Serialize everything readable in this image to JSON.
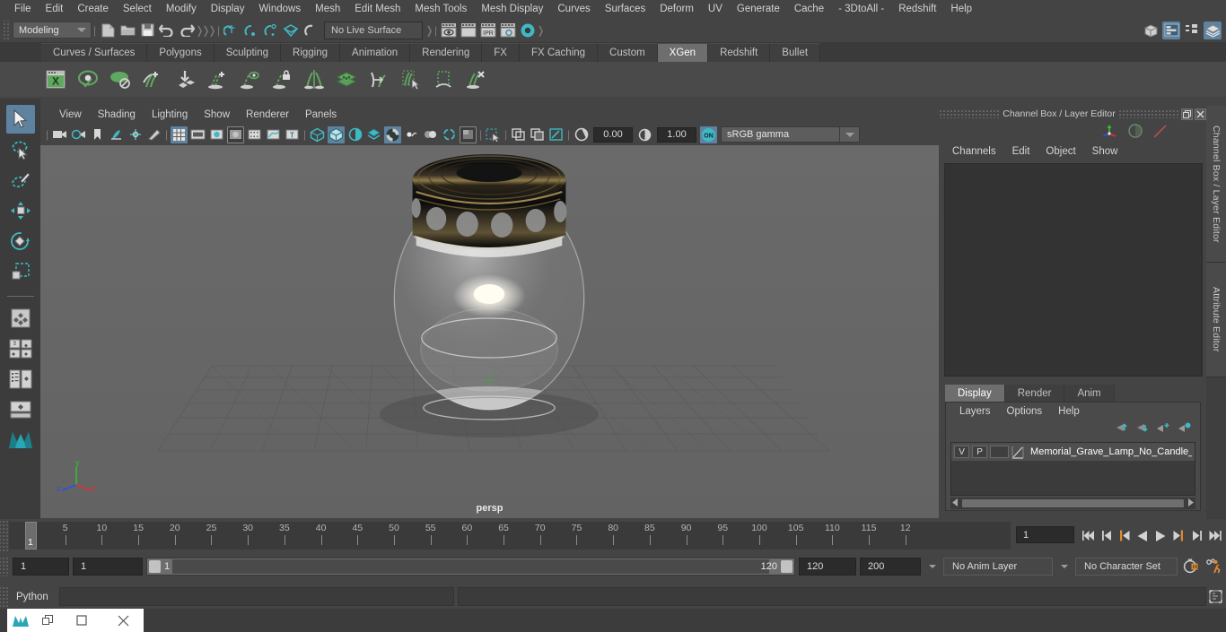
{
  "menubar": {
    "items": [
      "File",
      "Edit",
      "Create",
      "Select",
      "Modify",
      "Display",
      "Windows",
      "Mesh",
      "Edit Mesh",
      "Mesh Tools",
      "Mesh Display",
      "Curves",
      "Surfaces",
      "Deform",
      "UV",
      "Generate",
      "Cache",
      "- 3DtoAll -",
      "Redshift",
      "Help"
    ]
  },
  "statusbar": {
    "mode_menu": "Modeling",
    "live_surface": "No Live Surface",
    "icons": [
      "new-scene-icon",
      "open-scene-icon",
      "save-scene-icon",
      "undo-icon",
      "redo-icon",
      "select-by-hierarchy-icon",
      "select-by-object-icon",
      "select-by-component-icon",
      "snap-to-grid-icon",
      "snap-to-curve-icon",
      "snap-to-point-icon",
      "snap-to-projected-center-icon",
      "snap-to-view-plane-icon",
      "make-live-icon",
      "render-current-frame-icon",
      "render-sequence-icon",
      "ipr-render-icon",
      "render-settings-icon",
      "hypershade-icon"
    ],
    "right_icons": [
      "show-hide-modeling-toolkit-icon",
      "attribute-editor-icon",
      "tool-settings-icon",
      "channel-box-layer-editor-icon"
    ]
  },
  "shelf": {
    "tabs": [
      "Curves / Surfaces",
      "Polygons",
      "Sculpting",
      "Rigging",
      "Animation",
      "Rendering",
      "FX",
      "FX Caching",
      "Custom",
      "XGen",
      "Redshift",
      "Bullet"
    ],
    "active_tab": "XGen",
    "icons": [
      "xgen-editor-icon",
      "xgen-preview-icon",
      "xgen-disable-preview-icon",
      "xgen-add-groom-icon",
      "xgen-import-collection-icon",
      "xgen-create-description-icon",
      "xgen-preview-description-icon",
      "xgen-lock-description-icon",
      "xgen-mirror-description-icon",
      "xgen-guide-layers-icon",
      "xgen-convert-to-interactive-icon",
      "xgen-select-guides-icon",
      "xgen-region-tool-icon",
      "xgen-delete-guides-icon"
    ]
  },
  "toolbox": {
    "items": [
      {
        "name": "select-tool",
        "selected": true
      },
      {
        "name": "lasso-select-tool",
        "selected": false
      },
      {
        "name": "paint-select-tool",
        "selected": false
      },
      {
        "name": "move-tool",
        "selected": false
      },
      {
        "name": "rotate-tool",
        "selected": false
      },
      {
        "name": "scale-tool",
        "selected": false
      },
      {
        "name": "last-tool-used",
        "selected": false
      },
      {
        "name": "four-view-layout-icon",
        "selected": false
      },
      {
        "name": "persp-outliner-layout-icon",
        "selected": false
      },
      {
        "name": "persp-graph-layout-icon",
        "selected": false
      },
      {
        "name": "single-perspective-layout-icon",
        "selected": false
      },
      {
        "name": "maya-logo-icon",
        "selected": false
      }
    ]
  },
  "viewport": {
    "menu": [
      "View",
      "Shading",
      "Lighting",
      "Show",
      "Renderer",
      "Panels"
    ],
    "toolbar_values": {
      "exposure": "0.00",
      "gamma": "1.00",
      "color_space": "sRGB gamma",
      "view_transform_toggle": "ON"
    },
    "toolbar_icons": [
      "select-camera-icon",
      "camera-attributes-icon",
      "bookmark-icon",
      "image-plane-icon",
      "two-d-pan-zoom-icon",
      "grease-pencil-icon",
      "grid-icon",
      "film-gate-icon",
      "resolution-gate-icon",
      "gate-mask-icon",
      "film-origin-icon",
      "exposure-icon",
      "safe-title-icon",
      "wireframe-shading-icon",
      "smooth-shade-all-icon",
      "shaded-wireframe-icon",
      "use-all-lights-icon",
      "shadows-icon",
      "ambient-occlusion-icon",
      "motion-blur-icon",
      "anti-alias-icon",
      "multisample-icon",
      "depth-of-field-icon",
      "isolate-select-icon",
      "xray-icon",
      "xray-joints-icon",
      "xray-active-components-icon"
    ],
    "camera_label": "persp",
    "axis_labels": {
      "x": "x",
      "y": "y",
      "z": "z"
    },
    "scene_description": "transparent glass memorial grave lamp with black perforated metal lid on a ground grid"
  },
  "right_panel": {
    "title": "Channel Box / Layer Editor",
    "window_buttons": [
      "restore-icon",
      "close-icon"
    ],
    "gizmo_icons": [
      "move-axis-gizmo-icon",
      "rotate-gizmo-icon",
      "scale-gizmo-icon"
    ],
    "channel_menu": [
      "Channels",
      "Edit",
      "Object",
      "Show"
    ],
    "layer_tabs": [
      "Display",
      "Render",
      "Anim"
    ],
    "active_layer_tab": "Display",
    "layer_menu": [
      "Layers",
      "Options",
      "Help"
    ],
    "layer_buttons": [
      "move-layer-up-icon",
      "move-layer-down-icon",
      "create-empty-layer-icon",
      "create-layer-from-selected-icon"
    ],
    "layers": [
      {
        "visibility": "V",
        "playback": "P",
        "color_swatch": "",
        "type_icon": "layer-type-icon",
        "name": "Memorial_Grave_Lamp_No_Candle_la"
      }
    ],
    "vertical_tabs": [
      "Channel Box / Layer Editor",
      "Attribute Editor"
    ]
  },
  "timeline": {
    "tick_labels": [
      "5",
      "10",
      "15",
      "20",
      "25",
      "30",
      "35",
      "40",
      "45",
      "50",
      "55",
      "60",
      "65",
      "70",
      "75",
      "80",
      "85",
      "90",
      "95",
      "100",
      "105",
      "110",
      "115",
      "12"
    ],
    "current_frame_marker": "1",
    "current_frame_field": "1",
    "transport_icons": [
      "go-to-start-icon",
      "step-back-keyframe-icon",
      "step-back-frame-icon",
      "play-backwards-icon",
      "play-forwards-icon",
      "step-forward-frame-icon",
      "step-forward-keyframe-icon",
      "go-to-end-icon"
    ]
  },
  "range": {
    "anim_start": "1",
    "range_start": "1",
    "slider_start_label": "1",
    "slider_end_label": "120",
    "range_end": "120",
    "anim_end": "200",
    "anim_layer": "No Anim Layer",
    "character_set": "No Character Set",
    "right_icons": [
      "auto-key-icon",
      "animation-preferences-icon"
    ]
  },
  "command_line": {
    "language": "Python",
    "input_value": "",
    "output_value": "",
    "script_editor_icon": "script-editor-icon"
  },
  "os_overlay": {
    "buttons": [
      "app-icon",
      "minimize-icon",
      "maximize-icon",
      "close-icon"
    ]
  },
  "colors": {
    "accent_blue": "#5e83a1",
    "teal": "#3fb9c4",
    "xgen_green": "#5fa85f",
    "orange": "#e08a30",
    "panel_bg": "#444444",
    "viewport_bg": "#666666"
  }
}
